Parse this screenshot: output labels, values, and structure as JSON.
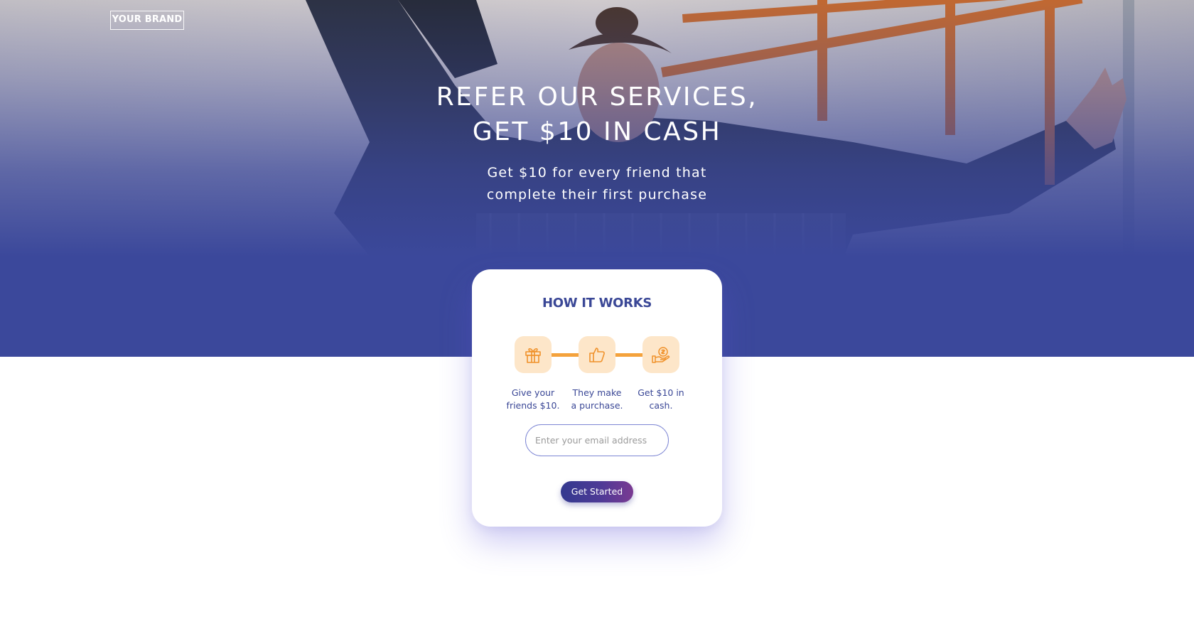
{
  "brand": {
    "label": "YOUR BRAND"
  },
  "hero": {
    "title_lines": [
      "REFER OUR SERVICES,",
      "GET $10 IN CASH"
    ],
    "subtitle_lines": [
      "Get $10 for every friend that",
      "complete their first purchase"
    ]
  },
  "how_it_works": {
    "title": "HOW IT WORKS",
    "steps": [
      {
        "icon": "gift-icon",
        "label_lines": [
          "Give your",
          "friends $10."
        ]
      },
      {
        "icon": "thumbs-up-icon",
        "label_lines": [
          "They make",
          "a purchase."
        ]
      },
      {
        "icon": "hand-coin-icon",
        "label_lines": [
          "Get $10 in",
          "cash."
        ]
      }
    ],
    "email": {
      "placeholder": "Enter your email address",
      "value": ""
    },
    "cta_label": "Get Started"
  },
  "colors": {
    "hero_blue": "#3b4a9a",
    "heading_blue": "#3a4796",
    "accent_orange": "#f4a23c",
    "icon_tile": "#fde6c9",
    "button_gradient_start": "#33398f",
    "button_gradient_end": "#7a3a92"
  }
}
